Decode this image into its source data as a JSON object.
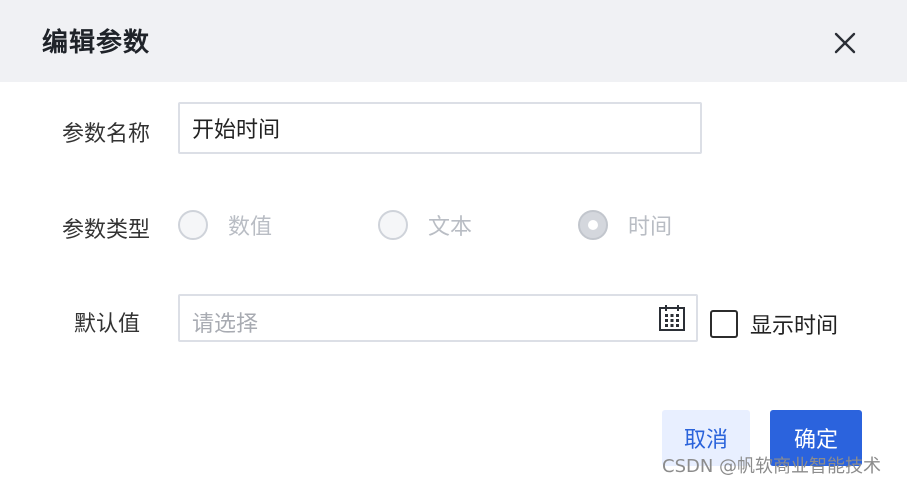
{
  "dialog": {
    "title": "编辑参数"
  },
  "form": {
    "name_label": "参数名称",
    "name_value": "开始时间",
    "type_label": "参数类型",
    "type_options": [
      {
        "label": "数值",
        "checked": false
      },
      {
        "label": "文本",
        "checked": false
      },
      {
        "label": "时间",
        "checked": true
      }
    ],
    "default_label": "默认值",
    "default_placeholder": "请选择",
    "show_time_label": "显示时间",
    "show_time_checked": false
  },
  "footer": {
    "cancel_label": "取消",
    "ok_label": "确定"
  },
  "watermark": "CSDN @帆软商业智能技术",
  "colors": {
    "header_bg": "#f0f1f4",
    "primary": "#2b63dd",
    "cancel_bg": "#e8efff"
  },
  "icons": {
    "close": "close-icon",
    "calendar": "calendar-icon"
  }
}
